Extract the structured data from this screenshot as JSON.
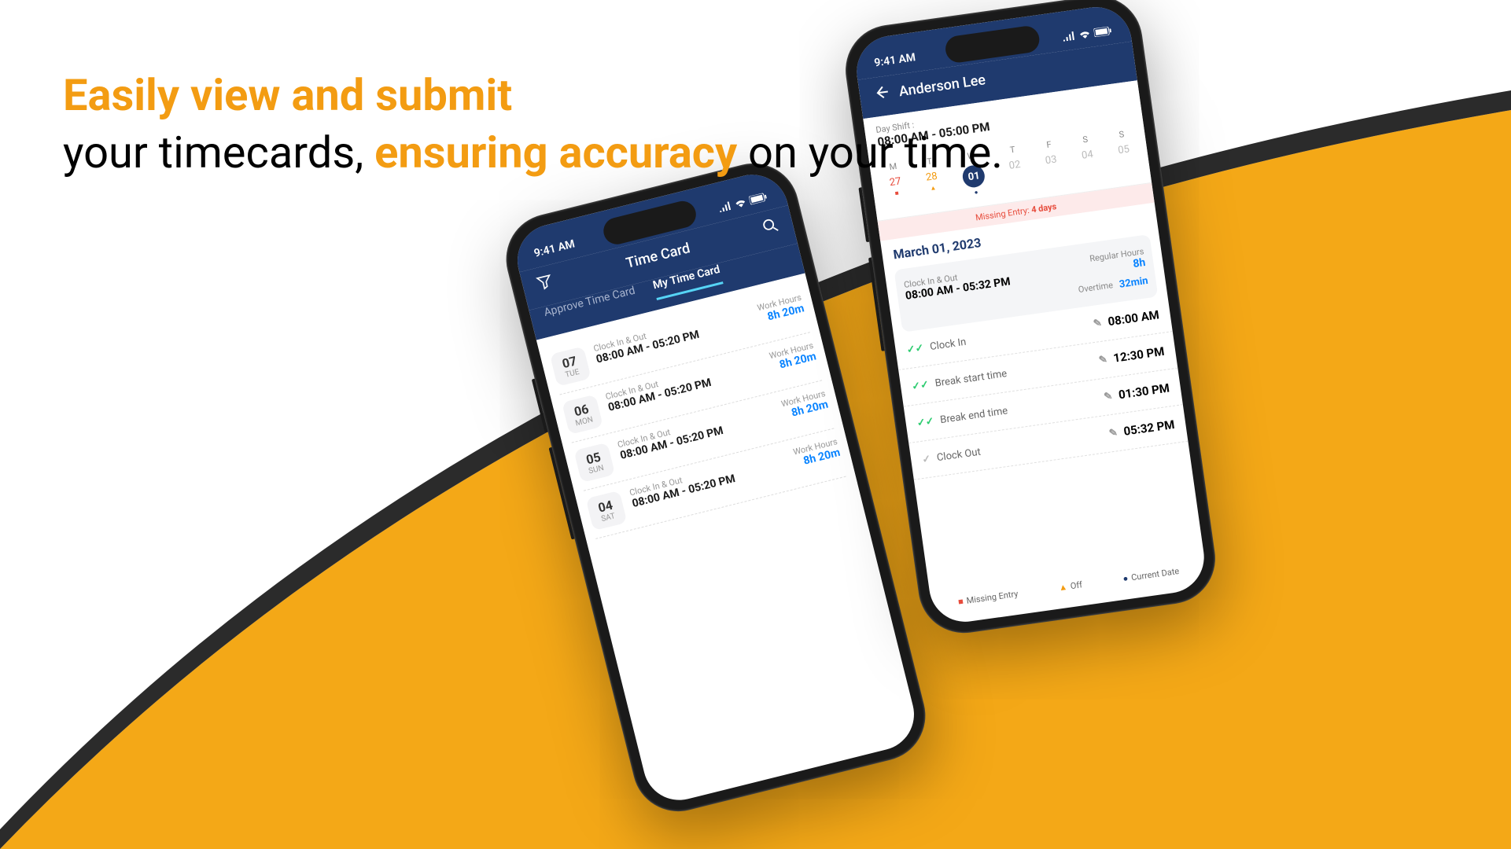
{
  "headline": {
    "p1": "Easily view and submit",
    "p2": "your timecards, ",
    "p3": "ensuring accuracy",
    "p4": " on your time."
  },
  "status_time": "9:41 AM",
  "phone1": {
    "title": "Time Card",
    "tab1": "Approve Time Card",
    "tab2": "My Time Card",
    "cio_label": "Clock In & Out",
    "wh_label": "Work Hours",
    "entries": [
      {
        "num": "07",
        "day": "TUE",
        "time": "08:00 AM - 05:20 PM",
        "wh": "8h 20m"
      },
      {
        "num": "06",
        "day": "MON",
        "time": "08:00 AM - 05:20 PM",
        "wh": "8h 20m"
      },
      {
        "num": "05",
        "day": "SUN",
        "time": "08:00 AM - 05:20 PM",
        "wh": "8h 20m"
      },
      {
        "num": "04",
        "day": "SAT",
        "time": "08:00 AM - 05:20 PM",
        "wh": "8h 20m"
      }
    ]
  },
  "phone2": {
    "back_name": "Anderson Lee",
    "shift_label": "Day Shift :",
    "shift_time": "08:00 AM - 05:00 PM",
    "week": [
      "M",
      "T",
      "W",
      "T",
      "F",
      "S",
      "S"
    ],
    "days": [
      "27",
      "28",
      "01",
      "02",
      "03",
      "04",
      "05"
    ],
    "missing": "Missing Entry: ",
    "missing_days": "4 days",
    "date": "March 01, 2023",
    "cio_label": "Clock In & Out",
    "cio_time": "08:00 AM - 05:32 PM",
    "rh_label": "Regular Hours",
    "rh_val": "8h",
    "ot_label": "Overtime",
    "ot_val": "32min",
    "details": [
      {
        "label": "Clock In",
        "time": "08:00 AM",
        "done": true
      },
      {
        "label": "Break start time",
        "time": "12:30 PM",
        "done": true
      },
      {
        "label": "Break end time",
        "time": "01:30 PM",
        "done": true
      },
      {
        "label": "Clock Out",
        "time": "05:32 PM",
        "done": false
      }
    ],
    "legend": {
      "missing": "Missing Entry",
      "off": "Off",
      "current": "Current Date"
    }
  }
}
